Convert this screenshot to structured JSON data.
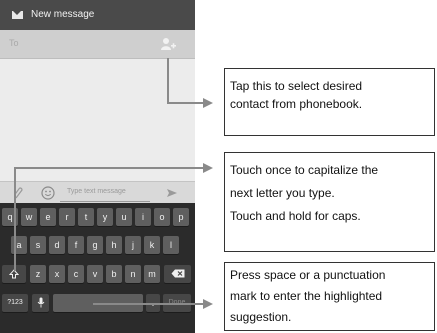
{
  "phone": {
    "title": "New message",
    "to_placeholder": "To",
    "compose_placeholder": "Type text message",
    "keyboard": {
      "row1": [
        "q",
        "w",
        "e",
        "r",
        "t",
        "y",
        "u",
        "i",
        "o",
        "p"
      ],
      "row2": [
        "a",
        "s",
        "d",
        "f",
        "g",
        "h",
        "j",
        "k",
        "l"
      ],
      "row3": [
        "z",
        "x",
        "c",
        "v",
        "b",
        "n",
        "m"
      ],
      "sym_label": "?123",
      "done_label": "Done"
    }
  },
  "annotations": {
    "contact": [
      "Tap this to select desired",
      "contact from phonebook."
    ],
    "caps": [
      "Touch once to capitalize the",
      "next letter you type.",
      "Touch and hold for caps."
    ],
    "space": [
      "Press space or a punctuation",
      "mark to enter the highlighted",
      "suggestion."
    ]
  },
  "colors": {
    "titlebar": "#4a4a4a",
    "keyboard": "#2b2b2b",
    "key": "#5f5f5f",
    "connector": "#8a8a8a"
  }
}
